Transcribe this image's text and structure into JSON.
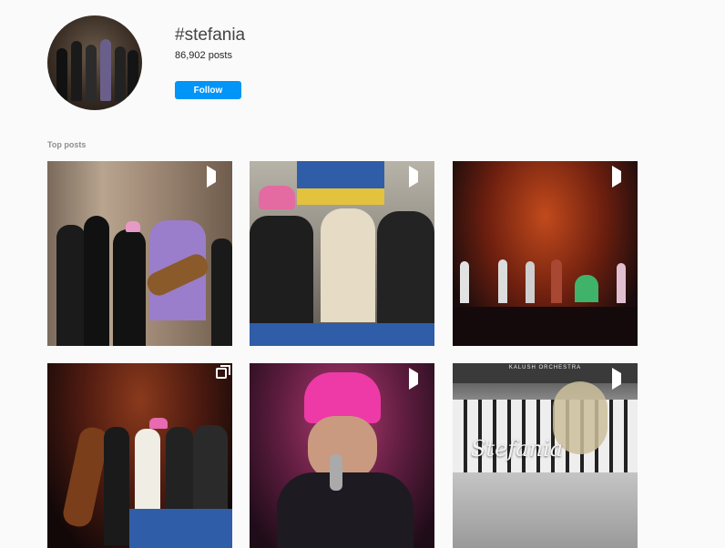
{
  "profile": {
    "hashtag": "#stefania",
    "post_count": "86,902 posts",
    "follow_label": "Follow",
    "follow_color": "#0095f6"
  },
  "section": {
    "label": "Top posts"
  },
  "posts": [
    {
      "badge": "play-icon",
      "text": ""
    },
    {
      "badge": "play-icon",
      "text": ""
    },
    {
      "badge": "play-icon",
      "text": ""
    },
    {
      "badge": "album-icon",
      "text": ""
    },
    {
      "badge": "play-icon",
      "text": ""
    },
    {
      "badge": "play-icon",
      "title_text": "Stefania",
      "band_text": "KALUSH ORCHESTRA"
    }
  ]
}
